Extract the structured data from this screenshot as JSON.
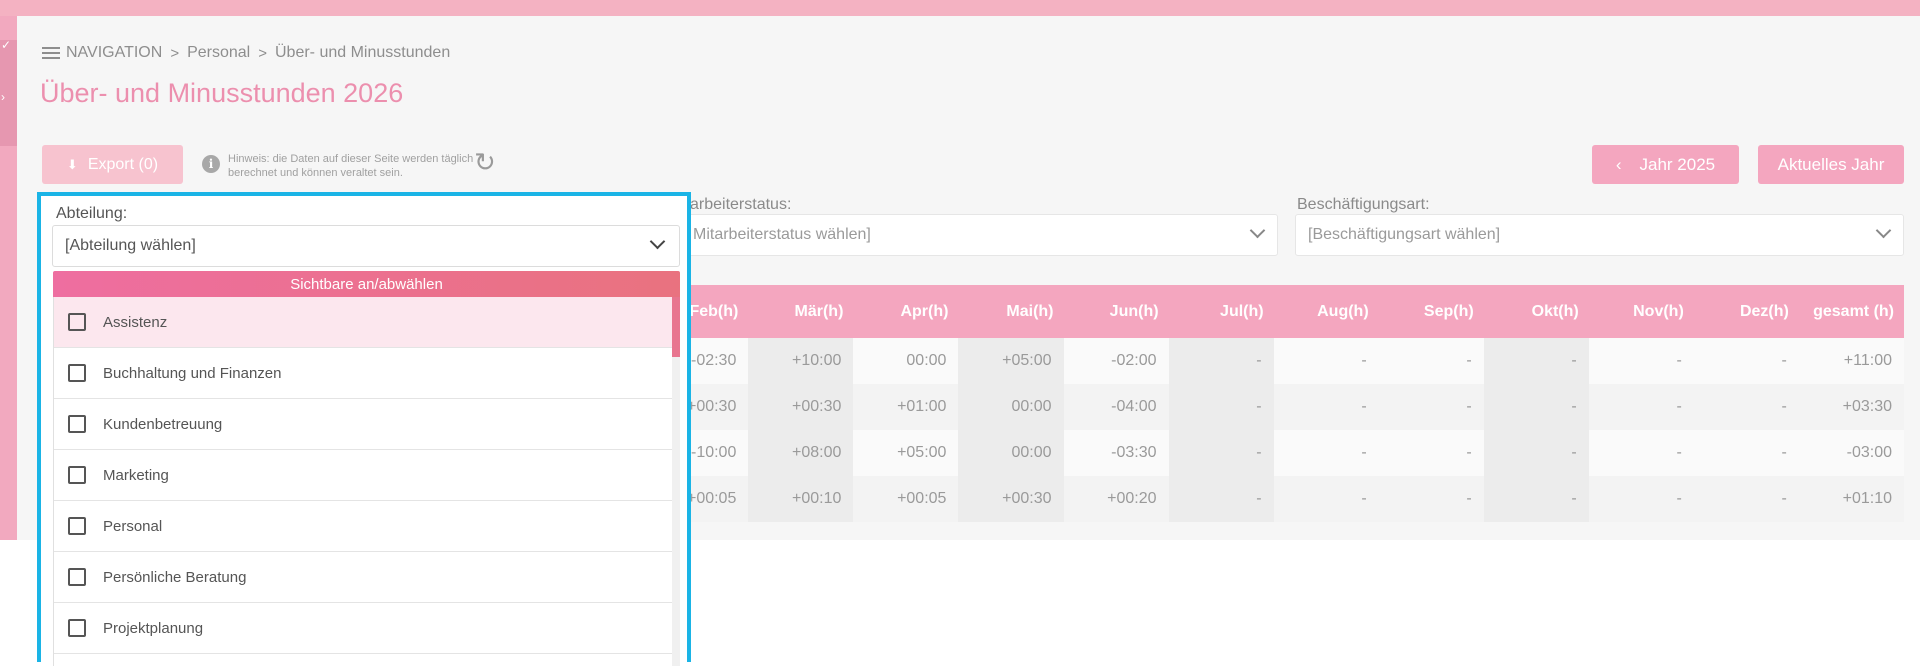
{
  "breadcrumb": {
    "root": "NAVIGATION",
    "items": [
      "Personal",
      "Über- und Minusstunden"
    ],
    "separator": ">"
  },
  "page_title": "Über- und Minusstunden 2026",
  "toolbar": {
    "export_label": "Export (0)",
    "hint_text": "Hinweis: die Daten auf dieser Seite werden täglich berechnet und können veraltet sein.",
    "prev_year_label": "Jahr 2025",
    "prev_year_icon": "‹",
    "current_year_label": "Aktuelles Jahr"
  },
  "filters": {
    "department": {
      "label": "Abteilung:",
      "placeholder": "[Abteilung wählen]"
    },
    "employee_status": {
      "label": "arbeiterstatus:",
      "placeholder": "Mitarbeiterstatus wählen]"
    },
    "employment_type": {
      "label": "Beschäftigungsart:",
      "placeholder": "[Beschäftigungsart wählen]"
    }
  },
  "dropdown": {
    "toggle_label": "Sichtbare an/abwählen",
    "options": [
      "Assistenz",
      "Buchhaltung und Finanzen",
      "Kundenbetreuung",
      "Marketing",
      "Personal",
      "Persönliche Beratung",
      "Projektplanung"
    ],
    "active_index": 0
  },
  "table": {
    "columns": [
      "Feb(h)",
      "Mär(h)",
      "Apr(h)",
      "Mai(h)",
      "Jun(h)",
      "Jul(h)",
      "Aug(h)",
      "Sep(h)",
      "Okt(h)",
      "Nov(h)",
      "Dez(h)",
      "gesamt (h)"
    ],
    "rows": [
      [
        "-02:30",
        "+10:00",
        "00:00",
        "+05:00",
        "-02:00",
        "-",
        "-",
        "-",
        "-",
        "-",
        "-",
        "+11:00"
      ],
      [
        "+00:30",
        "+00:30",
        "+01:00",
        "00:00",
        "-04:00",
        "-",
        "-",
        "-",
        "-",
        "-",
        "-",
        "+03:30"
      ],
      [
        "-10:00",
        "+08:00",
        "+05:00",
        "00:00",
        "-03:30",
        "-",
        "-",
        "-",
        "-",
        "-",
        "-",
        "-03:00"
      ],
      [
        "+00:05",
        "+00:10",
        "+00:05",
        "+00:30",
        "+00:20",
        "-",
        "-",
        "-",
        "-",
        "-",
        "-",
        "+01:10"
      ]
    ]
  },
  "icons": {
    "menu": "menu-icon",
    "info": "info-icon",
    "refresh": "refresh-icon",
    "download": "download-icon",
    "chevron_down": "chevron-down-icon",
    "chevron_left": "chevron-left-icon"
  },
  "colors": {
    "accent": "#f4a6bf",
    "title": "#ec8fae",
    "highlight_border": "#1ab4e6",
    "toggle_gradient_start": "#ee6ea0",
    "toggle_gradient_end": "#e9727f"
  }
}
